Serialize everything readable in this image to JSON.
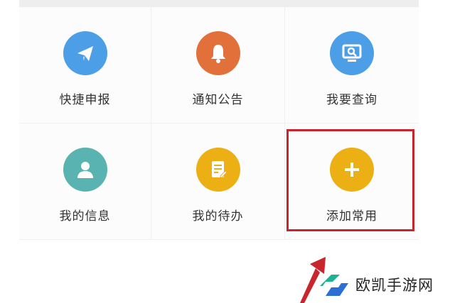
{
  "colors": {
    "blue": "#4c9ee6",
    "orange": "#e2703a",
    "teal": "#58b3b1",
    "yellow": "#ecb015",
    "highlight": "#c8262c",
    "watermark_green": "#1bb394",
    "watermark_blue": "#2b6fd6"
  },
  "grid": {
    "tiles": [
      {
        "label": "快捷申报",
        "icon": "paper-plane-icon",
        "color": "#4c9ee6"
      },
      {
        "label": "通知公告",
        "icon": "bell-icon",
        "color": "#e2703a"
      },
      {
        "label": "我要查询",
        "icon": "monitor-search-icon",
        "color": "#4c9ee6"
      },
      {
        "label": "我的信息",
        "icon": "user-icon",
        "color": "#58b3b1"
      },
      {
        "label": "我的待办",
        "icon": "document-edit-icon",
        "color": "#ecb015"
      },
      {
        "label": "添加常用",
        "icon": "plus-icon",
        "color": "#ecb015"
      }
    ]
  },
  "watermark": {
    "text": "欧凯手游网"
  }
}
